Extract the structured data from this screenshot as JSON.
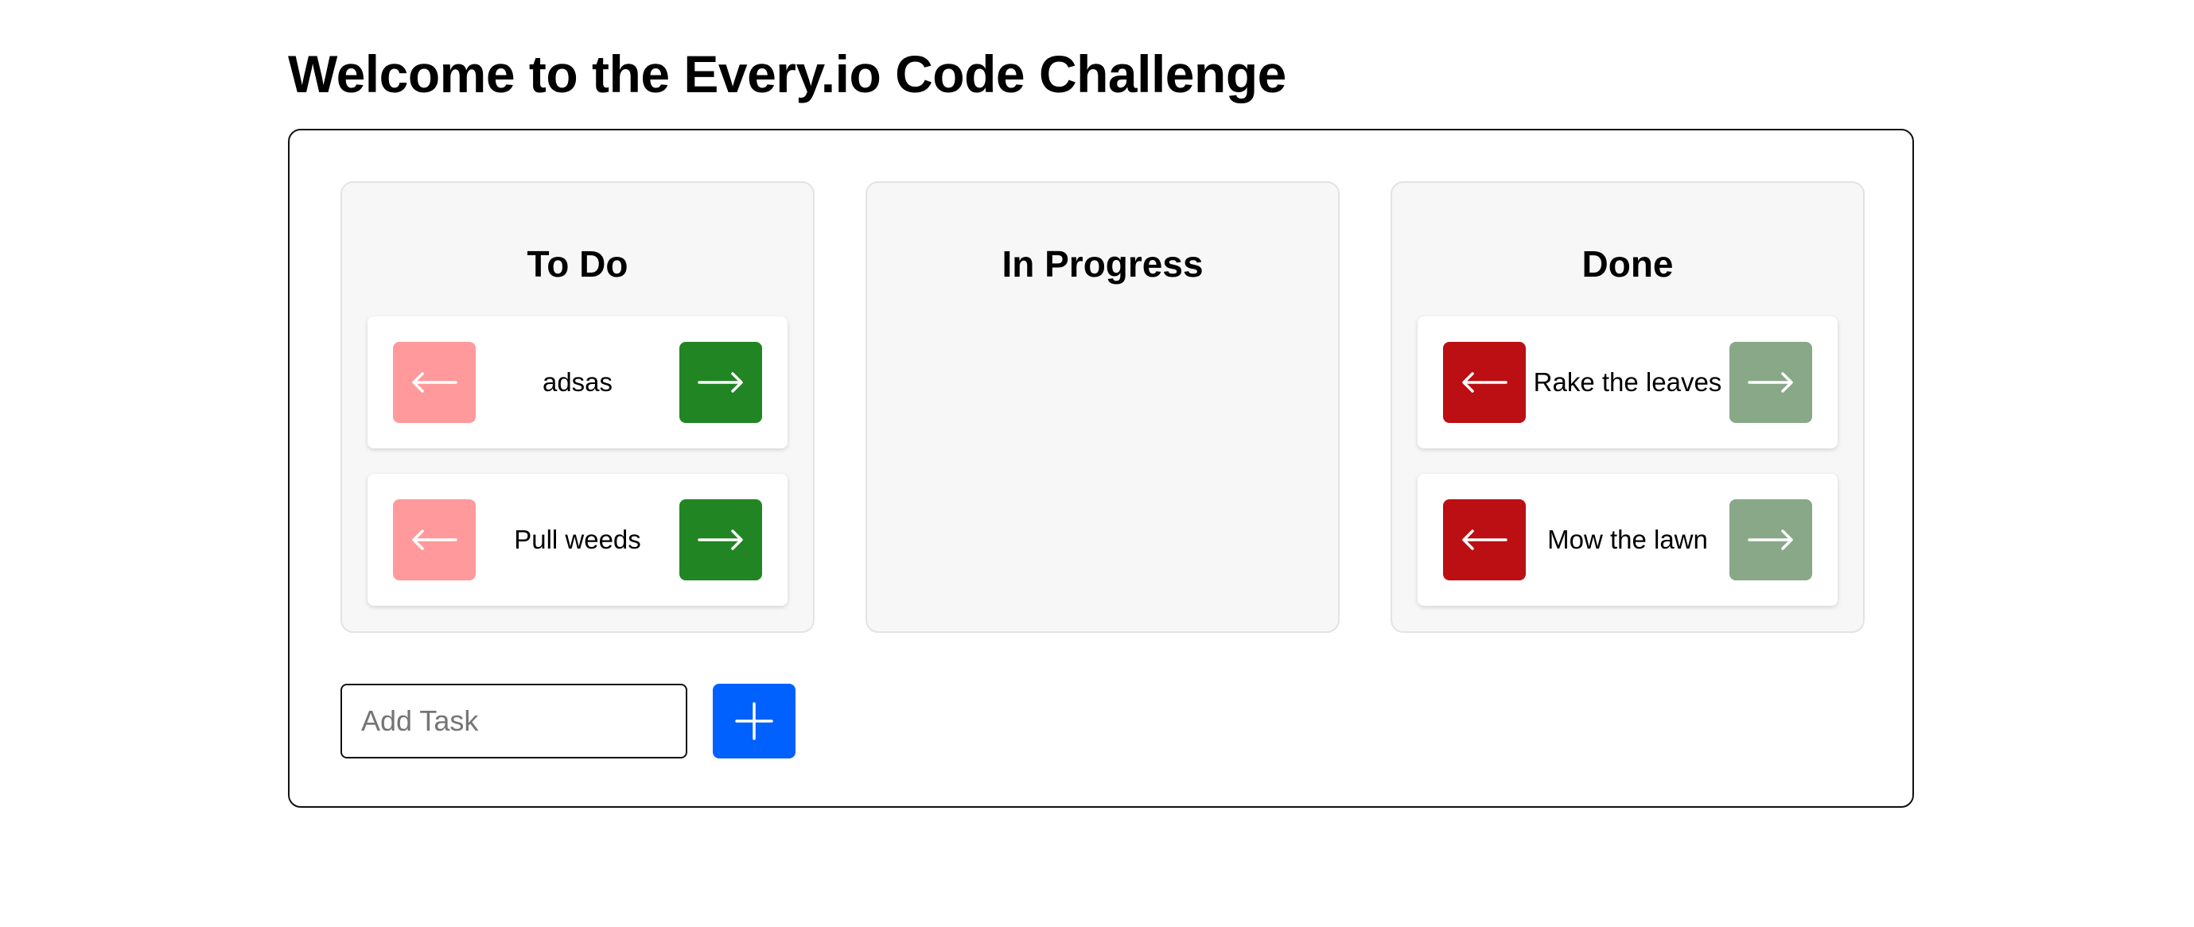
{
  "header": {
    "title": "Welcome to the Every.io Code Challenge"
  },
  "columns": [
    {
      "title": "To Do",
      "cards": [
        {
          "text": "adsas",
          "left_icon": "arrow-left-icon",
          "right_icon": "arrow-right-icon",
          "left_color": "#ff999b",
          "right_color": "#218523"
        },
        {
          "text": "Pull weeds",
          "left_icon": "arrow-left-icon",
          "right_icon": "arrow-right-icon",
          "left_color": "#ff999b",
          "right_color": "#218523"
        }
      ]
    },
    {
      "title": "In Progress",
      "cards": []
    },
    {
      "title": "Done",
      "cards": [
        {
          "text": "Rake the leaves",
          "left_icon": "arrow-left-icon",
          "right_icon": "arrow-right-icon",
          "left_color": "#bb0f13",
          "right_color": "#88a888"
        },
        {
          "text": "Mow the lawn",
          "left_icon": "arrow-left-icon",
          "right_icon": "arrow-right-icon",
          "left_color": "#bb0f13",
          "right_color": "#88a888"
        }
      ]
    }
  ],
  "add_task": {
    "placeholder": "Add Task",
    "value": "",
    "button_icon": "plus-icon",
    "button_color": "#0061fe"
  }
}
